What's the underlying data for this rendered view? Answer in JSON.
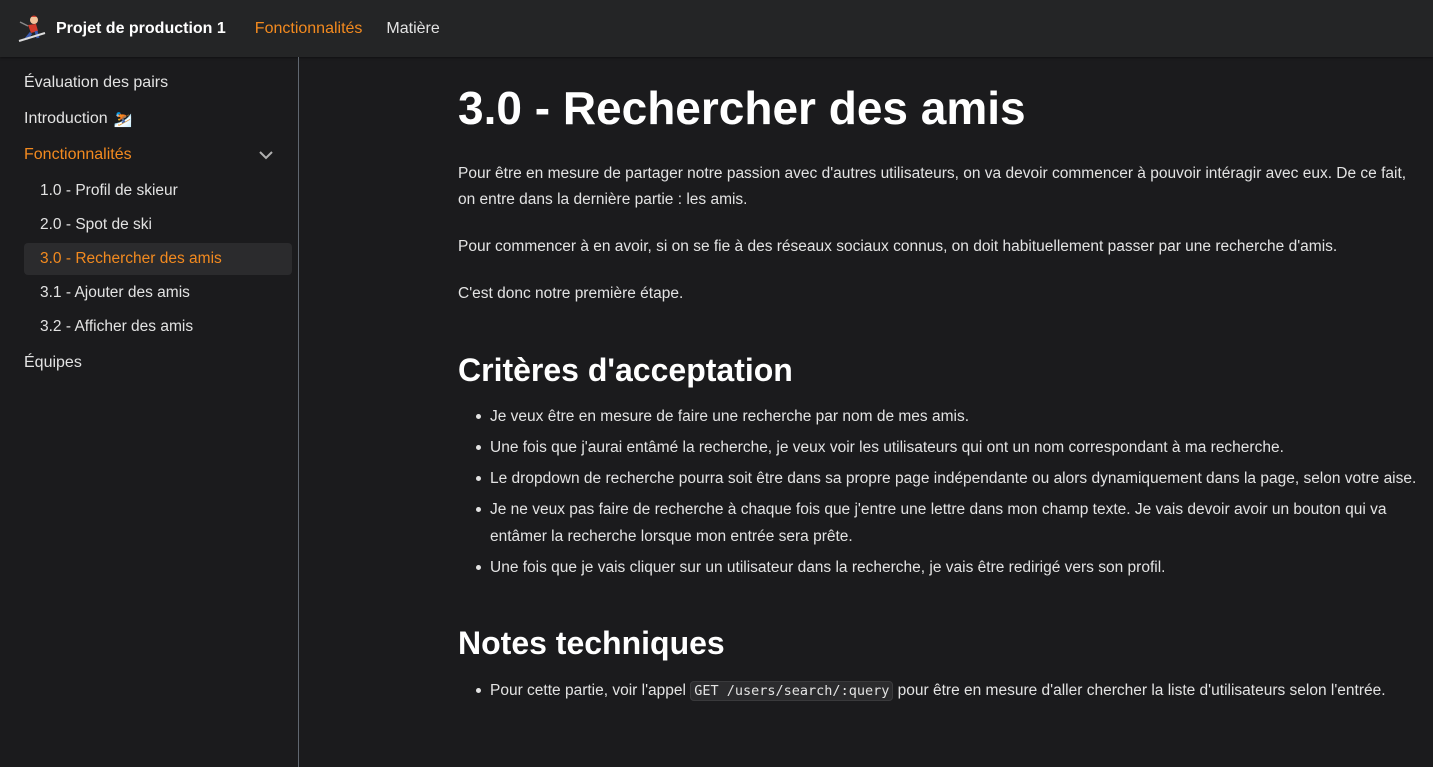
{
  "navbar": {
    "title": "Projet de production 1",
    "links": [
      {
        "label": "Fonctionnalités",
        "active": true
      },
      {
        "label": "Matière",
        "active": false
      }
    ]
  },
  "sidebar": {
    "items": [
      {
        "label": "Évaluation des pairs"
      },
      {
        "label": "Introduction",
        "emoji": "⛷️"
      },
      {
        "label": "Fonctionnalités"
      },
      {
        "label": "Équipes"
      }
    ],
    "sub_items": [
      {
        "label": "1.0 - Profil de skieur"
      },
      {
        "label": "2.0 - Spot de ski"
      },
      {
        "label": "3.0 - Rechercher des amis"
      },
      {
        "label": "3.1 - Ajouter des amis"
      },
      {
        "label": "3.2 - Afficher des amis"
      }
    ]
  },
  "article": {
    "title": "3.0 - Rechercher des amis",
    "paragraphs": [
      "Pour être en mesure de partager notre passion avec d'autres utilisateurs, on va devoir commencer à pouvoir intéragir avec eux. De ce fait, on entre dans la dernière partie : les amis.",
      "Pour commencer à en avoir, si on se fie à des réseaux sociaux connus, on doit habituellement passer par une recherche d'amis.",
      "C'est donc notre première étape."
    ],
    "criteria_heading": "Critères d'acceptation",
    "criteria": [
      "Je veux être en mesure de faire une recherche par nom de mes amis.",
      "Une fois que j'aurai entâmé la recherche, je veux voir les utilisateurs qui ont un nom correspondant à ma recherche.",
      "Le dropdown de recherche pourra soit être dans sa propre page indépendante ou alors dynamiquement dans la page, selon votre aise.",
      "Je ne veux pas faire de recherche à chaque fois que j'entre une lettre dans mon champ texte. Je vais devoir avoir un bouton qui va entâmer la recherche lorsque mon entrée sera prête.",
      "Une fois que je vais cliquer sur un utilisateur dans la recherche, je vais être redirigé vers son profil."
    ],
    "notes_heading": "Notes techniques",
    "notes": {
      "before": "Pour cette partie, voir l'appel ",
      "code": "GET /users/search/:query",
      "after": " pour être en mesure d'aller chercher la liste d'utilisateurs selon l'entrée."
    }
  },
  "colors": {
    "accent": "#f38a1f",
    "background": "#1b1b1d",
    "navbar": "#242526"
  }
}
